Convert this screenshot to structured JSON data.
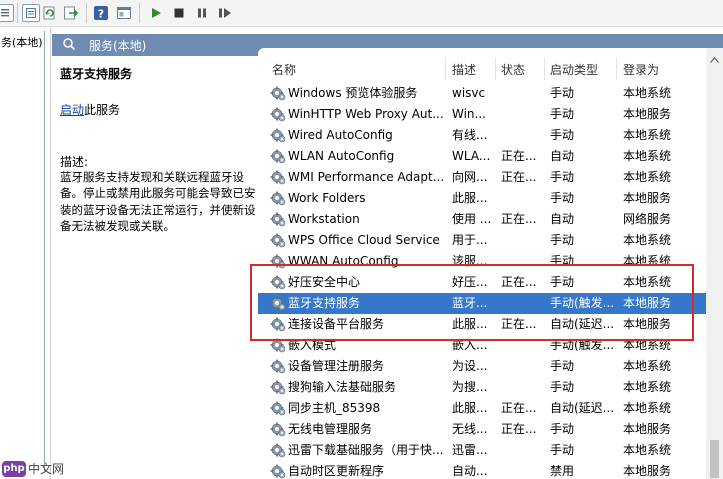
{
  "toolbar": {
    "icons": [
      "export-list-icon",
      "properties-icon",
      "refresh-icon",
      "export-icon",
      "help-icon",
      "console-tree-icon",
      "play-icon",
      "stop-icon",
      "pause-icon",
      "restart-icon"
    ]
  },
  "tree": {
    "selected_label": "务(本地)"
  },
  "header": {
    "title": "服务(本地)"
  },
  "detail": {
    "service_name": "蓝牙支持服务",
    "start_link": "启动",
    "start_suffix": "此服务",
    "desc_label": "描述:",
    "desc_text": "蓝牙服务支持发现和关联远程蓝牙设备。停止或禁用此服务可能会导致已安装的蓝牙设备无法正常运行，并使新设备无法被发现或关联。"
  },
  "columns": {
    "name": "名称",
    "desc": "描述",
    "status": "状态",
    "startup": "启动类型",
    "logon": "登录为"
  },
  "services": [
    {
      "name": "Windows 预览体验服务",
      "desc": "wisvc",
      "status": "",
      "startup": "手动",
      "logon": "本地系统"
    },
    {
      "name": "WinHTTP Web Proxy Aut...",
      "desc": "Win...",
      "status": "",
      "startup": "手动",
      "logon": "本地服务"
    },
    {
      "name": "Wired AutoConfig",
      "desc": "有线...",
      "status": "",
      "startup": "手动",
      "logon": "本地系统"
    },
    {
      "name": "WLAN AutoConfig",
      "desc": "WLA...",
      "status": "正在...",
      "startup": "自动",
      "logon": "本地系统"
    },
    {
      "name": "WMI Performance Adapt...",
      "desc": "向网...",
      "status": "正在...",
      "startup": "手动",
      "logon": "本地系统"
    },
    {
      "name": "Work Folders",
      "desc": "此服...",
      "status": "",
      "startup": "手动",
      "logon": "本地服务"
    },
    {
      "name": "Workstation",
      "desc": "使用 ...",
      "status": "正在...",
      "startup": "自动",
      "logon": "网络服务"
    },
    {
      "name": "WPS Office Cloud Service",
      "desc": "用于...",
      "status": "",
      "startup": "手动",
      "logon": "本地系统"
    },
    {
      "name": "WWAN AutoConfig",
      "desc": "该服...",
      "status": "",
      "startup": "手动",
      "logon": "本地系统"
    },
    {
      "name": "好压安全中心",
      "desc": "好压...",
      "status": "正在...",
      "startup": "手动",
      "logon": "本地系统"
    },
    {
      "name": "蓝牙支持服务",
      "desc": "蓝牙...",
      "status": "",
      "startup": "手动(触发...",
      "logon": "本地服务"
    },
    {
      "name": "连接设备平台服务",
      "desc": "此服...",
      "status": "正在...",
      "startup": "自动(延迟...",
      "logon": "本地服务"
    },
    {
      "name": "嵌入模式",
      "desc": "嵌入...",
      "status": "",
      "startup": "手动(触发...",
      "logon": "本地系统"
    },
    {
      "name": "设备管理注册服务",
      "desc": "为设...",
      "status": "",
      "startup": "手动",
      "logon": "本地系统"
    },
    {
      "name": "搜狗输入法基础服务",
      "desc": "为搜...",
      "status": "",
      "startup": "手动",
      "logon": "本地系统"
    },
    {
      "name": "同步主机_85398",
      "desc": "此服...",
      "status": "正在...",
      "startup": "自动(延迟...",
      "logon": "本地系统"
    },
    {
      "name": "无线电管理服务",
      "desc": "无线...",
      "status": "正在...",
      "startup": "手动",
      "logon": "本地服务"
    },
    {
      "name": "迅雷下载基础服务（用于快...",
      "desc": "迅雷...",
      "status": "",
      "startup": "手动",
      "logon": "本地系统"
    },
    {
      "name": "自动时区更新程序",
      "desc": "自动...",
      "status": "",
      "startup": "禁用",
      "logon": "本地服务"
    }
  ],
  "selected_index": 10,
  "highlight_color": "#d22b2b",
  "selection_color": "#3577c9",
  "watermark": {
    "logo": "php",
    "text": "中文网"
  }
}
